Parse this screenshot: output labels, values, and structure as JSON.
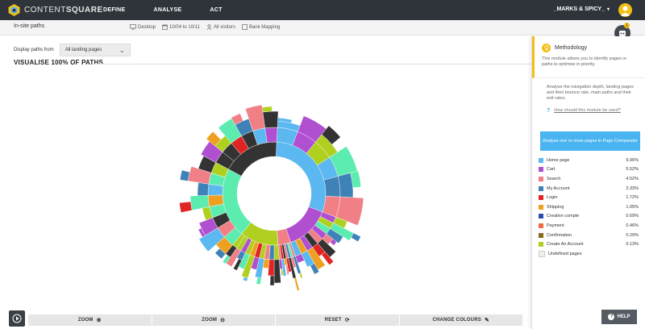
{
  "app": {
    "logo_text_light": "CONTENT",
    "logo_text_bold": "SQUARE",
    "nav": [
      "DEFINE",
      "ANALYSE",
      "ACT"
    ],
    "account": "_MARKS & SPICY_"
  },
  "subbar": {
    "title": "In-site paths",
    "filters": [
      {
        "icon": "desktop-icon",
        "label": "Desktop"
      },
      {
        "icon": "calendar-icon",
        "label": "10/04 to 10/11"
      },
      {
        "icon": "user-icon",
        "label": "All visitors"
      },
      {
        "icon": "page-icon",
        "label": "Bank Mapping"
      }
    ]
  },
  "controls": {
    "display_label": "Display paths from",
    "select_value": "All landing pages"
  },
  "section": {
    "title": "VISUALISE 100% OF PATHS"
  },
  "colors": {
    "home": "#5bb8f0",
    "cart": "#b04fd0",
    "search": "#f07f86",
    "my_account": "#3e82b8",
    "login": "#e02424",
    "shipping": "#f0a020",
    "creation": "#2b4fa8",
    "payment": "#f06a3e",
    "confirmation": "#8a6a1a",
    "create_account": "#b0d020",
    "undefined": "#f0efe8",
    "accent_cyan": "#5cecb0",
    "dark": "#333333"
  },
  "bottom_buttons": [
    {
      "label": "ZOOM",
      "icon": "zoom-in-icon"
    },
    {
      "label": "ZOOM",
      "icon": "zoom-out-icon"
    },
    {
      "label": "RESET",
      "icon": "reset-icon"
    },
    {
      "label": "CHANGE COLOURS",
      "icon": "pencil-icon"
    }
  ],
  "panel": {
    "title": "Methodology",
    "intro": "This module allows you to identify pages or paths to optimise in priority.",
    "body": "Analyse the navigation depth, landing pages and their bounce rate, main paths and their exit rates.",
    "help_link": "How should this module be used?",
    "cta": "Analyse one or more pages in Page Comparator",
    "legend": [
      {
        "name": "Home page",
        "value": "9.96%",
        "color": "#5bb8f0"
      },
      {
        "name": "Cart",
        "value": "5.52%",
        "color": "#b04fd0"
      },
      {
        "name": "Search",
        "value": "4.52%",
        "color": "#f07f86"
      },
      {
        "name": "My Account",
        "value": "2.33%",
        "color": "#3e82b8"
      },
      {
        "name": "Login",
        "value": "1.72%",
        "color": "#e02424"
      },
      {
        "name": "Shipping",
        "value": "1.05%",
        "color": "#f0a020"
      },
      {
        "name": "Creation compte",
        "value": "0.69%",
        "color": "#2b4fa8"
      },
      {
        "name": "Payment",
        "value": "0.46%",
        "color": "#f06a3e"
      },
      {
        "name": "Confirmation",
        "value": "0.29%",
        "color": "#8a6a1a"
      },
      {
        "name": "Create An Account",
        "value": "0.13%",
        "color": "#b0d020"
      },
      {
        "name": "Undefined pages",
        "value": "",
        "color": "#f0efe8"
      }
    ]
  },
  "help_button": "HELP",
  "notification_count": "1",
  "chart_data": {
    "type": "sunburst",
    "rings": [
      {
        "label": "Home page",
        "color": "#5bb8f0",
        "share": 0.3
      },
      {
        "label": "Cart",
        "color": "#b04fd0",
        "share": 0.14
      },
      {
        "label": "Search",
        "color": "#f07f86",
        "share": 0.04
      },
      {
        "label": "Create An Account",
        "color": "#b0d020",
        "share": 0.12
      },
      {
        "label": "cyan",
        "color": "#5cecb0",
        "share": 0.22
      },
      {
        "label": "dark",
        "color": "#333333",
        "share": 0.18
      }
    ]
  }
}
